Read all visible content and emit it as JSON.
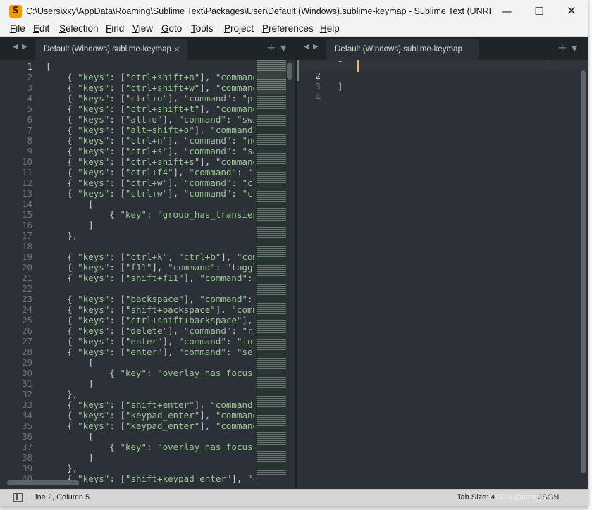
{
  "window": {
    "title": "C:\\Users\\xxy\\AppData\\Roaming\\Sublime Text\\Packages\\User\\Default (Windows).sublime-keymap - Sublime Text (UNREGIS...",
    "app_icon": "S",
    "controls": {
      "minimize": "—",
      "maximize": "☐",
      "close": "✕"
    }
  },
  "menu": [
    "File",
    "Edit",
    "Selection",
    "Find",
    "View",
    "Goto",
    "Tools",
    "Project",
    "Preferences",
    "Help"
  ],
  "left_pane": {
    "tab": {
      "label": "Default (Windows).sublime-keymap",
      "close": "×"
    },
    "current_line": 1,
    "lines": [
      {
        "n": "1",
        "t": [
          [
            "p",
            "["
          ]
        ]
      },
      {
        "n": "2",
        "t": [
          [
            "p",
            "    { "
          ],
          [
            "s",
            "\"keys\""
          ],
          [
            "p",
            ": ["
          ],
          [
            "s",
            "\"ctrl+shift+n\""
          ],
          [
            "p",
            "], "
          ],
          [
            "s",
            "\"command\""
          ],
          [
            "p",
            ": "
          ]
        ]
      },
      {
        "n": "3",
        "t": [
          [
            "p",
            "    { "
          ],
          [
            "s",
            "\"keys\""
          ],
          [
            "p",
            ": ["
          ],
          [
            "s",
            "\"ctrl+shift+w\""
          ],
          [
            "p",
            "], "
          ],
          [
            "s",
            "\"command\""
          ],
          [
            "p",
            ": "
          ]
        ]
      },
      {
        "n": "4",
        "t": [
          [
            "p",
            "    { "
          ],
          [
            "s",
            "\"keys\""
          ],
          [
            "p",
            ": ["
          ],
          [
            "s",
            "\"ctrl+o\""
          ],
          [
            "p",
            "], "
          ],
          [
            "s",
            "\"command\""
          ],
          [
            "p",
            ": "
          ],
          [
            "s",
            "\"prom"
          ]
        ]
      },
      {
        "n": "5",
        "t": [
          [
            "p",
            "    { "
          ],
          [
            "s",
            "\"keys\""
          ],
          [
            "p",
            ": ["
          ],
          [
            "s",
            "\"ctrl+shift+t\""
          ],
          [
            "p",
            "], "
          ],
          [
            "s",
            "\"command\""
          ],
          [
            "p",
            ": "
          ]
        ]
      },
      {
        "n": "6",
        "t": [
          [
            "p",
            "    { "
          ],
          [
            "s",
            "\"keys\""
          ],
          [
            "p",
            ": ["
          ],
          [
            "s",
            "\"alt+o\""
          ],
          [
            "p",
            "], "
          ],
          [
            "s",
            "\"command\""
          ],
          [
            "p",
            ": "
          ],
          [
            "s",
            "\"switc"
          ]
        ]
      },
      {
        "n": "7",
        "t": [
          [
            "p",
            "    { "
          ],
          [
            "s",
            "\"keys\""
          ],
          [
            "p",
            ": ["
          ],
          [
            "s",
            "\"alt+shift+o\""
          ],
          [
            "p",
            "], "
          ],
          [
            "s",
            "\"command\""
          ],
          [
            "p",
            ": "
          ]
        ]
      },
      {
        "n": "8",
        "t": [
          [
            "p",
            "    { "
          ],
          [
            "s",
            "\"keys\""
          ],
          [
            "p",
            ": ["
          ],
          [
            "s",
            "\"ctrl+n\""
          ],
          [
            "p",
            "], "
          ],
          [
            "s",
            "\"command\""
          ],
          [
            "p",
            ": "
          ],
          [
            "s",
            "\"new_"
          ]
        ]
      },
      {
        "n": "9",
        "t": [
          [
            "p",
            "    { "
          ],
          [
            "s",
            "\"keys\""
          ],
          [
            "p",
            ": ["
          ],
          [
            "s",
            "\"ctrl+s\""
          ],
          [
            "p",
            "], "
          ],
          [
            "s",
            "\"command\""
          ],
          [
            "p",
            ": "
          ],
          [
            "s",
            "\"save"
          ]
        ]
      },
      {
        "n": "10",
        "t": [
          [
            "p",
            "    { "
          ],
          [
            "s",
            "\"keys\""
          ],
          [
            "p",
            ": ["
          ],
          [
            "s",
            "\"ctrl+shift+s\""
          ],
          [
            "p",
            "], "
          ],
          [
            "s",
            "\"command\""
          ],
          [
            "p",
            ": "
          ]
        ]
      },
      {
        "n": "11",
        "t": [
          [
            "p",
            "    { "
          ],
          [
            "s",
            "\"keys\""
          ],
          [
            "p",
            ": ["
          ],
          [
            "s",
            "\"ctrl+f4\""
          ],
          [
            "p",
            "], "
          ],
          [
            "s",
            "\"command\""
          ],
          [
            "p",
            ": "
          ],
          [
            "s",
            "\"clo"
          ]
        ]
      },
      {
        "n": "12",
        "t": [
          [
            "p",
            "    { "
          ],
          [
            "s",
            "\"keys\""
          ],
          [
            "p",
            ": ["
          ],
          [
            "s",
            "\"ctrl+w\""
          ],
          [
            "p",
            "], "
          ],
          [
            "s",
            "\"command\""
          ],
          [
            "p",
            ": "
          ],
          [
            "s",
            "\"clos"
          ]
        ]
      },
      {
        "n": "13",
        "t": [
          [
            "p",
            "    { "
          ],
          [
            "s",
            "\"keys\""
          ],
          [
            "p",
            ": ["
          ],
          [
            "s",
            "\"ctrl+w\""
          ],
          [
            "p",
            "], "
          ],
          [
            "s",
            "\"command\""
          ],
          [
            "p",
            ": "
          ],
          [
            "s",
            "\"clos"
          ]
        ]
      },
      {
        "n": "14",
        "t": [
          [
            "p",
            "        ["
          ]
        ]
      },
      {
        "n": "15",
        "t": [
          [
            "p",
            "            { "
          ],
          [
            "s",
            "\"key\""
          ],
          [
            "p",
            ": "
          ],
          [
            "s",
            "\"group_has_transient_"
          ]
        ]
      },
      {
        "n": "16",
        "t": [
          [
            "p",
            "        ]"
          ]
        ]
      },
      {
        "n": "17",
        "t": [
          [
            "p",
            "    },"
          ]
        ]
      },
      {
        "n": "18",
        "t": []
      },
      {
        "n": "19",
        "t": [
          [
            "p",
            "    { "
          ],
          [
            "s",
            "\"keys\""
          ],
          [
            "p",
            ": ["
          ],
          [
            "s",
            "\"ctrl+k\""
          ],
          [
            "p",
            ", "
          ],
          [
            "s",
            "\"ctrl+b\""
          ],
          [
            "p",
            "], "
          ],
          [
            "s",
            "\"comma"
          ]
        ]
      },
      {
        "n": "20",
        "t": [
          [
            "p",
            "    { "
          ],
          [
            "s",
            "\"keys\""
          ],
          [
            "p",
            ": ["
          ],
          [
            "s",
            "\"f11\""
          ],
          [
            "p",
            "], "
          ],
          [
            "s",
            "\"command\""
          ],
          [
            "p",
            ": "
          ],
          [
            "s",
            "\"toggle_"
          ]
        ]
      },
      {
        "n": "21",
        "t": [
          [
            "p",
            "    { "
          ],
          [
            "s",
            "\"keys\""
          ],
          [
            "p",
            ": ["
          ],
          [
            "s",
            "\"shift+f11\""
          ],
          [
            "p",
            "], "
          ],
          [
            "s",
            "\"command\""
          ],
          [
            "p",
            ": "
          ],
          [
            "s",
            "\"t"
          ]
        ]
      },
      {
        "n": "22",
        "t": []
      },
      {
        "n": "23",
        "t": [
          [
            "p",
            "    { "
          ],
          [
            "s",
            "\"keys\""
          ],
          [
            "p",
            ": ["
          ],
          [
            "s",
            "\"backspace\""
          ],
          [
            "p",
            "], "
          ],
          [
            "s",
            "\"command\""
          ],
          [
            "p",
            ": "
          ],
          [
            "s",
            "\"l"
          ]
        ]
      },
      {
        "n": "24",
        "t": [
          [
            "p",
            "    { "
          ],
          [
            "s",
            "\"keys\""
          ],
          [
            "p",
            ": ["
          ],
          [
            "s",
            "\"shift+backspace\""
          ],
          [
            "p",
            "], "
          ],
          [
            "s",
            "\"comma"
          ]
        ]
      },
      {
        "n": "25",
        "t": [
          [
            "p",
            "    { "
          ],
          [
            "s",
            "\"keys\""
          ],
          [
            "p",
            ": ["
          ],
          [
            "s",
            "\"ctrl+shift+backspace\""
          ],
          [
            "p",
            "], "
          ],
          [
            "s",
            "\"c"
          ]
        ]
      },
      {
        "n": "26",
        "t": [
          [
            "p",
            "    { "
          ],
          [
            "s",
            "\"keys\""
          ],
          [
            "p",
            ": ["
          ],
          [
            "s",
            "\"delete\""
          ],
          [
            "p",
            "], "
          ],
          [
            "s",
            "\"command\""
          ],
          [
            "p",
            ": "
          ],
          [
            "s",
            "\"righ"
          ]
        ]
      },
      {
        "n": "27",
        "t": [
          [
            "p",
            "    { "
          ],
          [
            "s",
            "\"keys\""
          ],
          [
            "p",
            ": ["
          ],
          [
            "s",
            "\"enter\""
          ],
          [
            "p",
            "], "
          ],
          [
            "s",
            "\"command\""
          ],
          [
            "p",
            ": "
          ],
          [
            "s",
            "\"inser"
          ]
        ]
      },
      {
        "n": "28",
        "t": [
          [
            "p",
            "    { "
          ],
          [
            "s",
            "\"keys\""
          ],
          [
            "p",
            ": ["
          ],
          [
            "s",
            "\"enter\""
          ],
          [
            "p",
            "], "
          ],
          [
            "s",
            "\"command\""
          ],
          [
            "p",
            ": "
          ],
          [
            "s",
            "\"selec"
          ]
        ]
      },
      {
        "n": "29",
        "t": [
          [
            "p",
            "        ["
          ]
        ]
      },
      {
        "n": "30",
        "t": [
          [
            "p",
            "            { "
          ],
          [
            "s",
            "\"key\""
          ],
          [
            "p",
            ": "
          ],
          [
            "s",
            "\"overlay_has_focus\""
          ],
          [
            "p",
            ","
          ]
        ]
      },
      {
        "n": "31",
        "t": [
          [
            "p",
            "        ]"
          ]
        ]
      },
      {
        "n": "32",
        "t": [
          [
            "p",
            "    },"
          ]
        ]
      },
      {
        "n": "33",
        "t": [
          [
            "p",
            "    { "
          ],
          [
            "s",
            "\"keys\""
          ],
          [
            "p",
            ": ["
          ],
          [
            "s",
            "\"shift+enter\""
          ],
          [
            "p",
            "], "
          ],
          [
            "s",
            "\"command\""
          ],
          [
            "p",
            ": "
          ]
        ]
      },
      {
        "n": "34",
        "t": [
          [
            "p",
            "    { "
          ],
          [
            "s",
            "\"keys\""
          ],
          [
            "p",
            ": ["
          ],
          [
            "s",
            "\"keypad_enter\""
          ],
          [
            "p",
            "], "
          ],
          [
            "s",
            "\"command\""
          ],
          [
            "p",
            ":"
          ]
        ]
      },
      {
        "n": "35",
        "t": [
          [
            "p",
            "    { "
          ],
          [
            "s",
            "\"keys\""
          ],
          [
            "p",
            ": ["
          ],
          [
            "s",
            "\"keypad_enter\""
          ],
          [
            "p",
            "], "
          ],
          [
            "s",
            "\"command\""
          ],
          [
            "p",
            ":"
          ]
        ]
      },
      {
        "n": "36",
        "t": [
          [
            "p",
            "        ["
          ]
        ]
      },
      {
        "n": "37",
        "t": [
          [
            "p",
            "            { "
          ],
          [
            "s",
            "\"key\""
          ],
          [
            "p",
            ": "
          ],
          [
            "s",
            "\"overlay_has_focus\""
          ],
          [
            "p",
            ","
          ]
        ]
      },
      {
        "n": "38",
        "t": [
          [
            "p",
            "        ]"
          ]
        ]
      },
      {
        "n": "39",
        "t": [
          [
            "p",
            "    },"
          ]
        ]
      },
      {
        "n": "40",
        "t": [
          [
            "p",
            "    { "
          ],
          [
            "s",
            "\"keys\""
          ],
          [
            "p",
            ": ["
          ],
          [
            "s",
            "\"shift+keypad_enter\""
          ],
          [
            "p",
            "], "
          ],
          [
            "s",
            "\"com"
          ]
        ]
      }
    ]
  },
  "right_pane": {
    "tab": {
      "label": "Default (Windows).sublime-keymap",
      "close": "×"
    },
    "current_line": 2,
    "lines": [
      {
        "n": "",
        "t": "-"
      },
      {
        "n": "2",
        "t": ""
      },
      {
        "n": "3",
        "t": "]"
      },
      {
        "n": "4",
        "t": ""
      }
    ]
  },
  "tabstrip_glyphs": {
    "back": "◀",
    "forward": "▶",
    "new_tab": "+",
    "tab_list": "▼"
  },
  "status": {
    "position": "Line 2, Column 5",
    "tab_size": "Tab Size: 4",
    "syntax": "JSON",
    "watermark": "CSDN @sam_hong"
  },
  "colors": {
    "editor_bg": "#2b3136",
    "string": "#99c794",
    "caret": "#f9ae58",
    "app_icon": "#ff9800"
  }
}
